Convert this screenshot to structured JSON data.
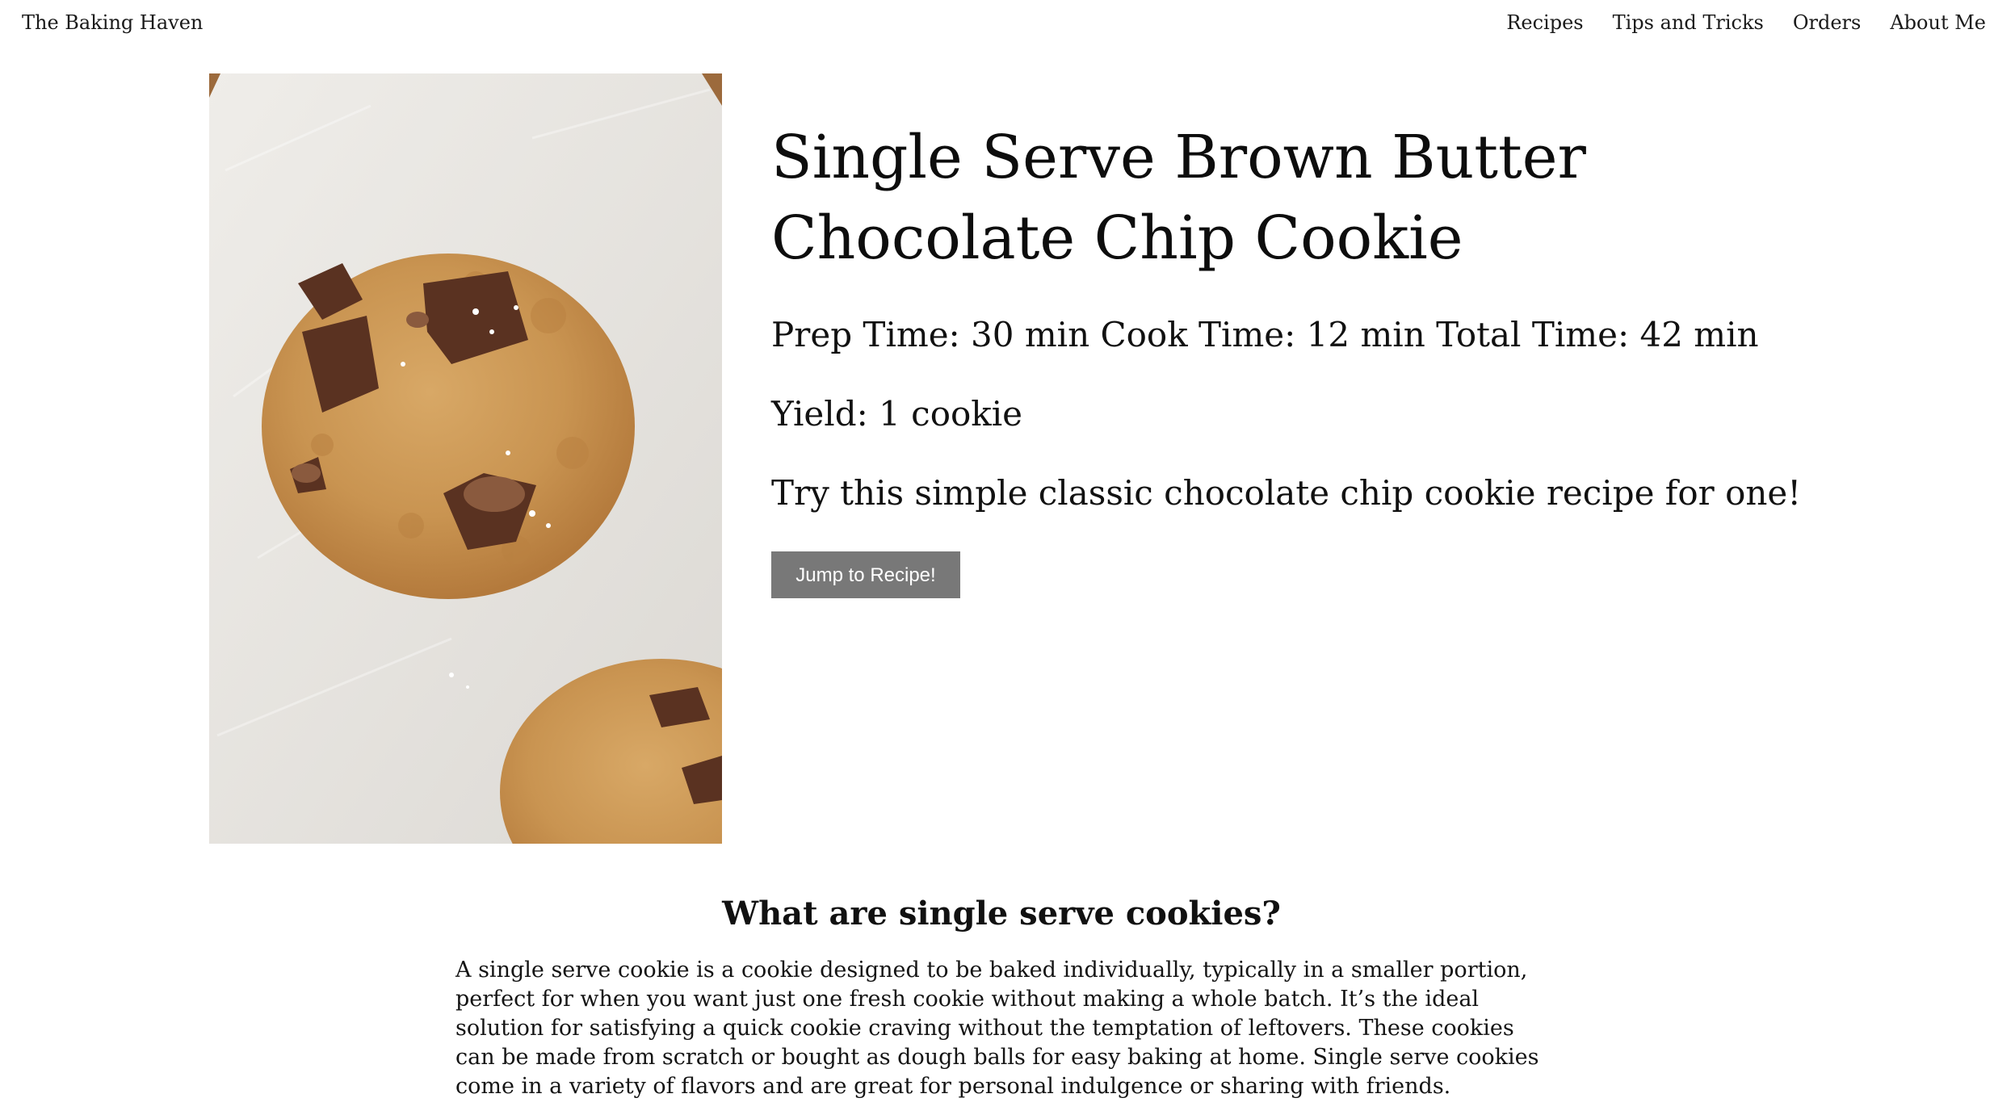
{
  "header": {
    "brand": "The Baking Haven",
    "nav": [
      "Recipes",
      "Tips and Tricks",
      "Orders",
      "About Me"
    ]
  },
  "hero": {
    "image_alt": "brown butter chocolate chip cookie photo",
    "title": "Single Serve Brown Butter Chocolate Chip Cookie",
    "times": "Prep Time: 30 min Cook Time: 12 min Total Time: 42 min",
    "yield": "Yield: 1 cookie",
    "tagline": "Try this simple classic chocolate chip cookie recipe for one!",
    "button_label": "Jump to Recipe!"
  },
  "section": {
    "heading": "What are single serve cookies?",
    "body": "A single serve cookie is a cookie designed to be baked individually, typically in a smaller portion, perfect for when you want just one fresh cookie without making a whole batch. It’s the ideal solution for satisfying a quick cookie craving without the temptation of leftovers. These cookies can be made from scratch or bought as dough balls for easy baking at home. Single serve cookies come in a variety of flavors and are great for personal indulgence or sharing with friends."
  },
  "colors": {
    "button_bg": "#787878",
    "button_text": "#ffffff",
    "text": "#111111",
    "background": "#ffffff"
  }
}
